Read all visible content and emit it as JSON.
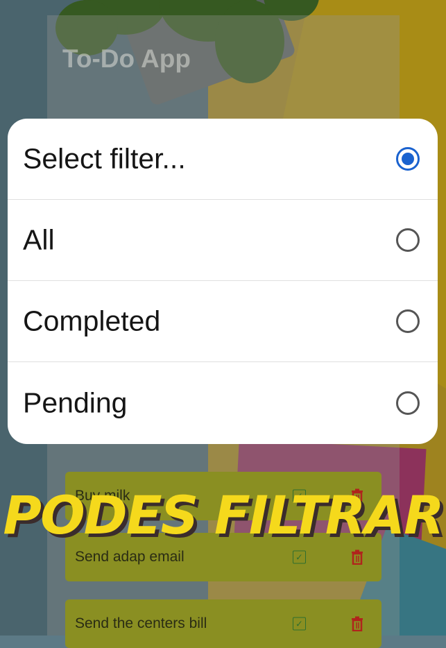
{
  "app": {
    "title": "To-Do App"
  },
  "filter_dialog": {
    "options": [
      {
        "label": "Select filter...",
        "selected": true
      },
      {
        "label": "All",
        "selected": false
      },
      {
        "label": "Completed",
        "selected": false
      },
      {
        "label": "Pending",
        "selected": false
      }
    ],
    "accent_color": "#1a62cf"
  },
  "tasks": [
    {
      "text": "Buy milk",
      "completed": true
    },
    {
      "text": "Send adap email",
      "completed": true
    },
    {
      "text": "Send the centers bill",
      "completed": true
    }
  ],
  "caption": {
    "text": "PODES FILTRAR",
    "color": "#f5d91c"
  },
  "icons": {
    "check": "checkbox-checked-icon",
    "delete": "trash-icon"
  }
}
